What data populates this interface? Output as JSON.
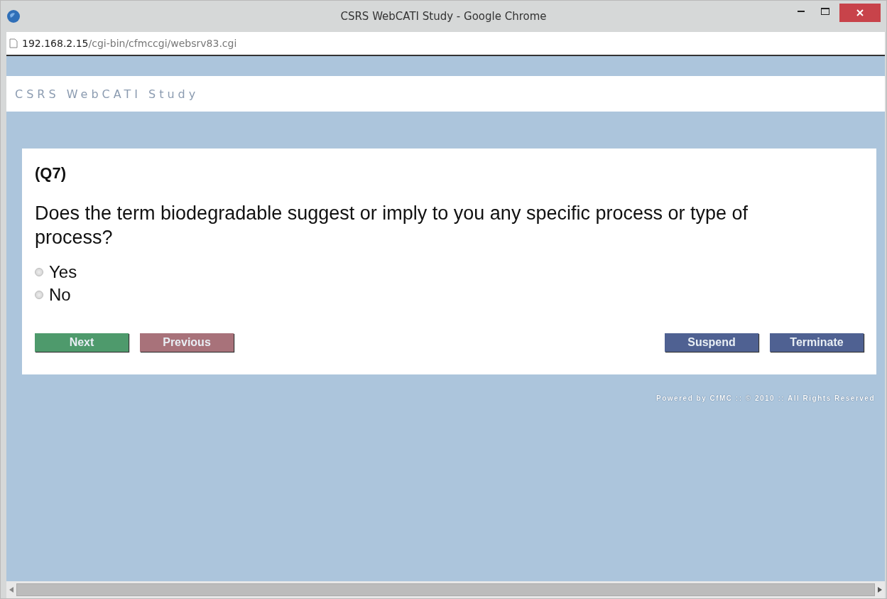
{
  "window": {
    "title": "CSRS WebCATI Study - Google Chrome"
  },
  "address_bar": {
    "host": "192.168.2.15",
    "path": "/cgi-bin/cfmccgi/websrv83.cgi"
  },
  "site_header": {
    "title": "CSRS WebCATI Study"
  },
  "question": {
    "number": "(Q7)",
    "text": "Does the term biodegradable suggest or imply to you any specific process or type of process?",
    "options": [
      {
        "label": "Yes",
        "selected": false
      },
      {
        "label": "No",
        "selected": false
      }
    ]
  },
  "buttons": [
    {
      "label": "Next",
      "kind": "next"
    },
    {
      "label": "Previous",
      "kind": "previous"
    },
    {
      "label": "Suspend",
      "kind": "suspend"
    },
    {
      "label": "Terminate",
      "kind": "terminate"
    }
  ],
  "footer": "Powered by CfMC :: © 2010 :: All Rights Reserved"
}
